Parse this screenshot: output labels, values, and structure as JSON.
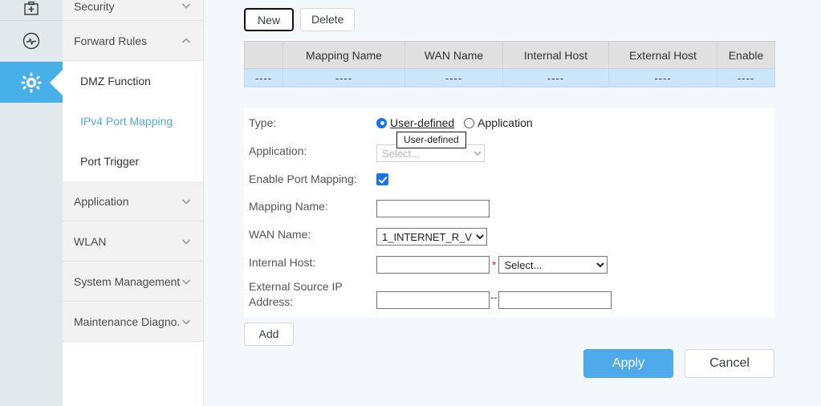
{
  "rail": {
    "items": [
      {
        "name": "toolbox-plus-icon",
        "icon": "toolbox-plus-icon",
        "active": false
      },
      {
        "name": "monitor-pulse-icon",
        "icon": "monitor-pulse-icon",
        "active": false
      },
      {
        "name": "gear-icon",
        "icon": "gear-icon",
        "active": true
      }
    ],
    "active_color": "#47b0e8",
    "background": "#e2e9ec"
  },
  "sidebar": {
    "groups": [
      {
        "label": "Security",
        "expanded": false,
        "chevron": "chevron-down-icon"
      },
      {
        "label": "Forward Rules",
        "expanded": true,
        "chevron": "chevron-up-icon"
      },
      {
        "label": "Application",
        "expanded": false,
        "chevron": "chevron-down-icon"
      },
      {
        "label": "WLAN",
        "expanded": false,
        "chevron": "chevron-down-icon"
      },
      {
        "label": "System Management",
        "expanded": false,
        "chevron": "chevron-down-icon"
      },
      {
        "label": "Maintenance Diagno..",
        "expanded": false,
        "chevron": "chevron-down-icon"
      }
    ],
    "submenu": [
      {
        "label": "DMZ Function",
        "active": false
      },
      {
        "label": "IPv4 Port Mapping",
        "active": true
      },
      {
        "label": "Port Trigger",
        "active": false
      }
    ],
    "active_link_color": "#5aa7dd"
  },
  "toolbar": {
    "new_label": "New",
    "delete_label": "Delete"
  },
  "table": {
    "headers": [
      "",
      "Mapping Name",
      "WAN Name",
      "Internal Host",
      "External Host",
      "Enable"
    ],
    "rows": [
      [
        "----",
        "----",
        "----",
        "----",
        "----",
        "----"
      ]
    ],
    "header_bg": "#e0e0e0",
    "row_bg": "#cbe6fa"
  },
  "form": {
    "type": {
      "label": "Type:",
      "options": [
        {
          "label": "User-defined",
          "selected": true,
          "hovered": true
        },
        {
          "label": "Application",
          "selected": false,
          "hovered": false
        }
      ],
      "tooltip": "User-defined"
    },
    "application": {
      "label": "Application:",
      "value": "Select...",
      "disabled": true
    },
    "enable_port_mapping": {
      "label": "Enable Port Mapping:",
      "checked": true
    },
    "mapping_name": {
      "label": "Mapping Name:",
      "value": "",
      "placeholder": ""
    },
    "wan_name": {
      "label": "WAN Name:",
      "value": "1_INTERNET_R_V"
    },
    "internal_host": {
      "label": "Internal Host:",
      "value": "",
      "required_mark": "*",
      "select_value": "Select..."
    },
    "external_source_ip": {
      "label": "External Source IP Address:",
      "label_line1": "External Source IP",
      "label_line2": "Address:",
      "start_value": "",
      "separator": "--",
      "end_value": ""
    },
    "add_label": "Add"
  },
  "footer": {
    "apply_label": "Apply",
    "cancel_label": "Cancel",
    "apply_color": "#4eaaea"
  }
}
